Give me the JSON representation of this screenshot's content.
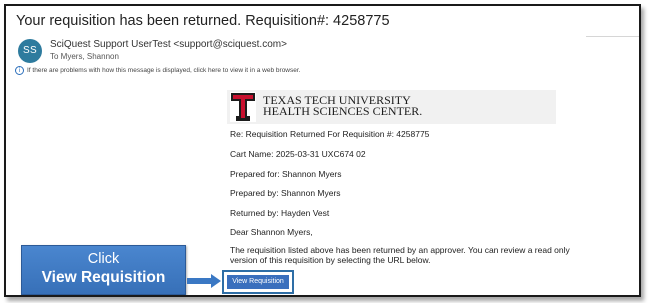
{
  "email": {
    "subject": "Your requisition has been returned. Requisition#: 4258775",
    "sender": {
      "initials": "SS",
      "avatar_color": "#2e7b9e",
      "display": "SciQuest Support UserTest <support@sciquest.com>"
    },
    "to": "To  Myers, Shannon",
    "info_bar": "If there are problems with how this message is displayed, click here to view it in a web browser.",
    "info_icon": "info-icon"
  },
  "logo": {
    "line1": "TEXAS TECH UNIVERSITY",
    "line2": "HEALTH SCIENCES CENTER.",
    "mark_letter": "T",
    "brand_color": "#c8102e"
  },
  "body": {
    "re_line": "Re: Requisition Returned For Requisition #: 4258775",
    "cart_name": "Cart Name: 2025-03-31 UXC674 02",
    "prepared_for": "Prepared for: Shannon Myers",
    "prepared_by": "Prepared by: Shannon Myers",
    "returned_by": "Returned by: Hayden Vest",
    "greeting": "Dear Shannon Myers,",
    "paragraph": "The requisition listed above has been returned by an approver. You can review a read only version of this requisition by selecting the URL below.",
    "view_button": "View Requisition",
    "button_color": "#3a6fbd"
  },
  "callout": {
    "line1": "Click",
    "line2": "View Requisition",
    "color": "#4a86cf",
    "arrow_icon": "right-arrow-icon"
  }
}
